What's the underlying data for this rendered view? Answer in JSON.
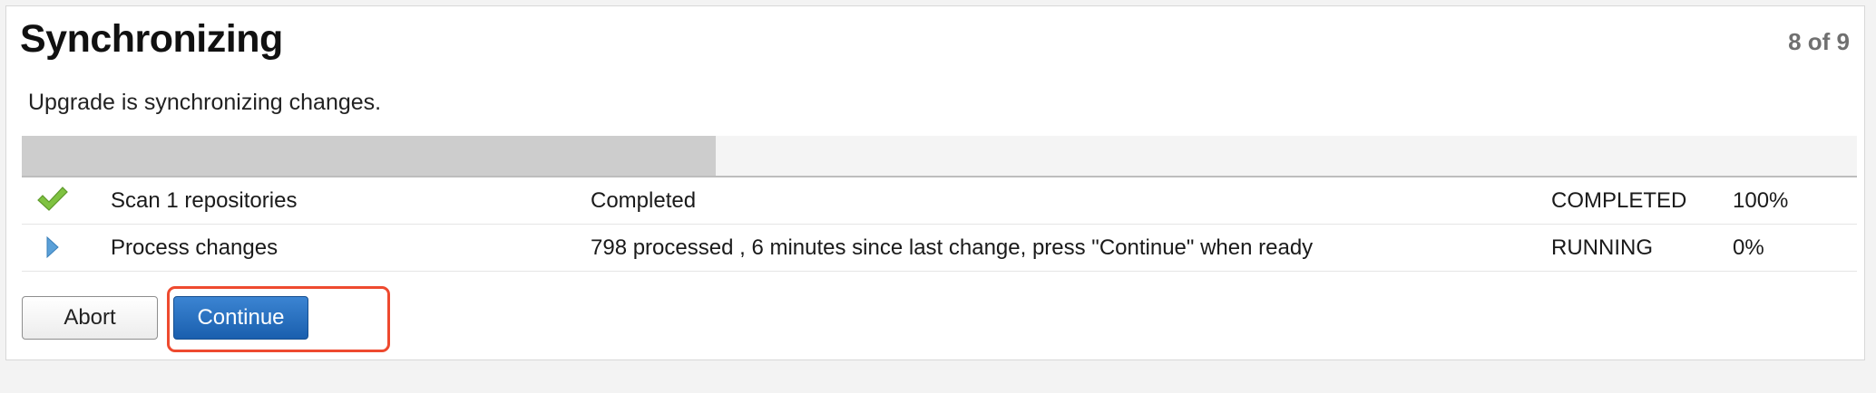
{
  "header": {
    "title": "Synchronizing",
    "step": "8 of 9"
  },
  "description": "Upgrade is synchronizing changes.",
  "progress": {
    "fraction": 0.378
  },
  "tasks": [
    {
      "icon": "check-icon",
      "name": "Scan 1 repositories",
      "detail": "Completed",
      "status": "COMPLETED",
      "percent": "100%"
    },
    {
      "icon": "play-arrow-icon",
      "name": "Process changes",
      "detail": "798 processed , 6 minutes since last change, press \"Continue\" when ready",
      "status": "RUNNING",
      "percent": "0%"
    }
  ],
  "actions": {
    "abort_label": "Abort",
    "continue_label": "Continue"
  },
  "colors": {
    "primary_button": "#1f68b9",
    "check": "#7fc241",
    "running_arrow": "#5aa0d8",
    "highlight": "#ee4a2f"
  }
}
